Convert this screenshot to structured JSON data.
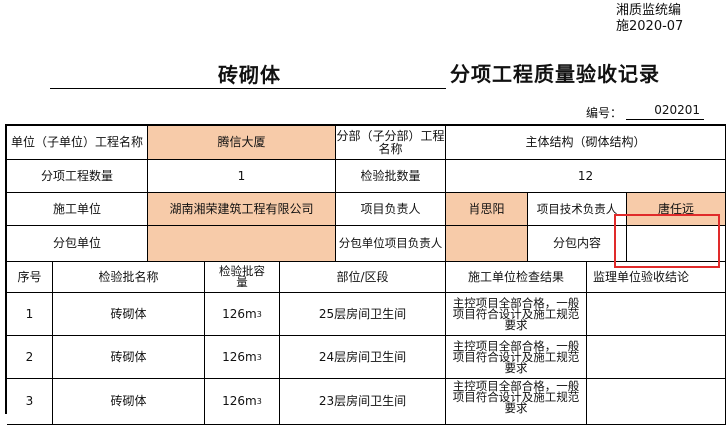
{
  "header": {
    "code_line1": "湘质监统编",
    "code_line2": "施2020-07",
    "title_left": "砖砌体",
    "title_right": "分项工程质量验收记录",
    "number_label": "编号：",
    "number_value": "020201"
  },
  "info": {
    "unit_label": "单位（子单位）工程名称",
    "unit_value": "腾信大厦",
    "subdiv_label": "分部（子分部）工程名称",
    "subdiv_value": "主体结构（砌体结构）",
    "item_count_label": "分项工程数量",
    "item_count_value": "1",
    "batch_count_label": "检验批数量",
    "batch_count_value": "12",
    "contractor_label": "施工单位",
    "contractor_value": "湖南湘荣建筑工程有限公司",
    "pm_label": "项目负责人",
    "pm_value": "肖思阳",
    "tech_label": "项目技术负责人",
    "tech_value": "唐任远",
    "subcontractor_label": "分包单位",
    "subcontractor_value": "",
    "sub_pm_label": "分包单位项目负责人",
    "sub_pm_value": "",
    "sub_content_label": "分包内容",
    "sub_content_value": ""
  },
  "table": {
    "headers": {
      "seq": "序号",
      "batch_name": "检验批名称",
      "capacity": "检验批容量",
      "location": "部位/区段",
      "contractor_result": "施工单位检查结果",
      "supervisor_result": "监理单位验收结论"
    },
    "rows": [
      {
        "seq": "1",
        "name": "砖砌体",
        "capacity": "126m",
        "unit_sup": "3",
        "location": "25层房间卫生间",
        "result": "主控项目全部合格，一般项目符合设计及施工规范要求",
        "supervisor": ""
      },
      {
        "seq": "2",
        "name": "砖砌体",
        "capacity": "126m",
        "unit_sup": "3",
        "location": "24层房间卫生间",
        "result": "主控项目全部合格，一般项目符合设计及施工规范要求",
        "supervisor": ""
      },
      {
        "seq": "3",
        "name": "砖砌体",
        "capacity": "126m",
        "unit_sup": "3",
        "location": "23层房间卫生间",
        "result": "主控项目全部合格，一般项目符合设计及施工规范要求",
        "supervisor": ""
      }
    ]
  },
  "colors": {
    "peach_fill": "#f7cba9",
    "highlight_border": "#e02a2a"
  }
}
